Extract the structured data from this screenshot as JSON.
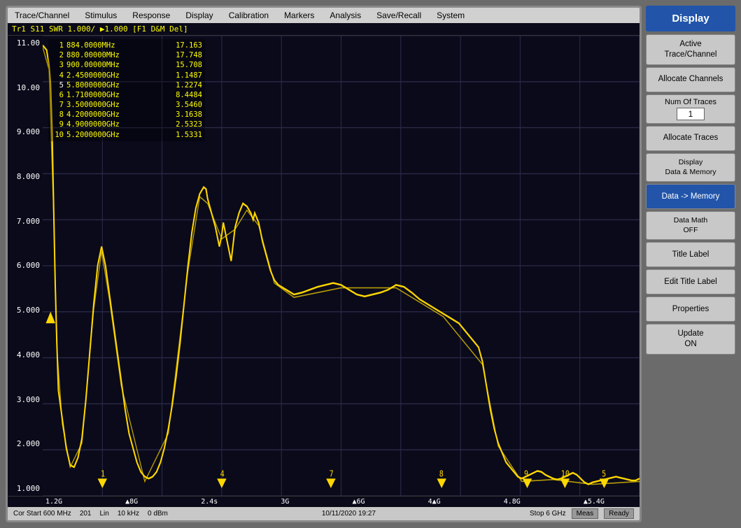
{
  "menubar": {
    "items": [
      "Trace/Channel",
      "Stimulus",
      "Response",
      "Display",
      "Calibration",
      "Markers",
      "Analysis",
      "Save/Recall",
      "System"
    ]
  },
  "trace_info": {
    "label": "Tr1  S11  SWR  1.000/ ▶1.000  [F1 D&M Del]"
  },
  "markers": [
    {
      "num": "1",
      "freq": "884.0000MHz",
      "val": "17.163"
    },
    {
      "num": "2",
      "freq": "880.00000MHz",
      "val": "17.748"
    },
    {
      "num": "3",
      "freq": "900.00000MHz",
      "val": "15.708"
    },
    {
      "num": "4",
      "freq": "2.4500000GHz",
      "val": "1.1487"
    },
    {
      "num": "5",
      "freq": "5.8000000GHz",
      "val": "1.2274"
    },
    {
      "num": "6",
      "freq": "1.7100000GHz",
      "val": "8.4484"
    },
    {
      "num": "7",
      "freq": "3.5000000GHz",
      "val": "3.5460"
    },
    {
      "num": "8",
      "freq": "4.2000000GHz",
      "val": "3.1638"
    },
    {
      "num": "9",
      "freq": "4.9000000GHz",
      "val": "2.5323"
    },
    {
      "num": "10",
      "freq": "5.2000000GHz",
      "val": "1.5331"
    }
  ],
  "y_axis": {
    "labels": [
      "11.00",
      "10.00",
      "9.000",
      "8.000",
      "7.000",
      "6.000",
      "5.000",
      "4.000",
      "3.000",
      "2.000",
      "1.000"
    ]
  },
  "x_axis": {
    "labels": [
      "1.2G",
      "8G",
      "2.4s",
      "3G",
      "6G",
      "4▲G",
      "4.8G",
      "5.4G"
    ]
  },
  "status_bar": {
    "left": [
      "Cor  Start 600 MHz",
      "201",
      "Lin",
      "10 kHz",
      "0 dBm"
    ],
    "datetime": "10/11/2020 19:27",
    "stop": "Stop 6 GHz",
    "badges": [
      "Meas",
      "Ready"
    ]
  },
  "right_panel": {
    "header": "Display",
    "buttons": [
      {
        "id": "active-trace",
        "label": "Active\nTrace/Channel"
      },
      {
        "id": "allocate-channels",
        "label": "Allocate Channels"
      },
      {
        "id": "num-of-traces",
        "label": "Num Of Traces",
        "value": "1"
      },
      {
        "id": "allocate-traces",
        "label": "Allocate Traces"
      },
      {
        "id": "display-data-memory",
        "label": "Display\nData & Memory"
      },
      {
        "id": "data-to-memory",
        "label": "Data -> Memory",
        "active": true
      },
      {
        "id": "data-math",
        "label": "Data Math\nOFF"
      },
      {
        "id": "title-label",
        "label": "Title Label"
      },
      {
        "id": "edit-title-label",
        "label": "Edit Title Label"
      },
      {
        "id": "properties",
        "label": "Properties"
      },
      {
        "id": "update-on",
        "label": "Update\nON"
      }
    ]
  }
}
